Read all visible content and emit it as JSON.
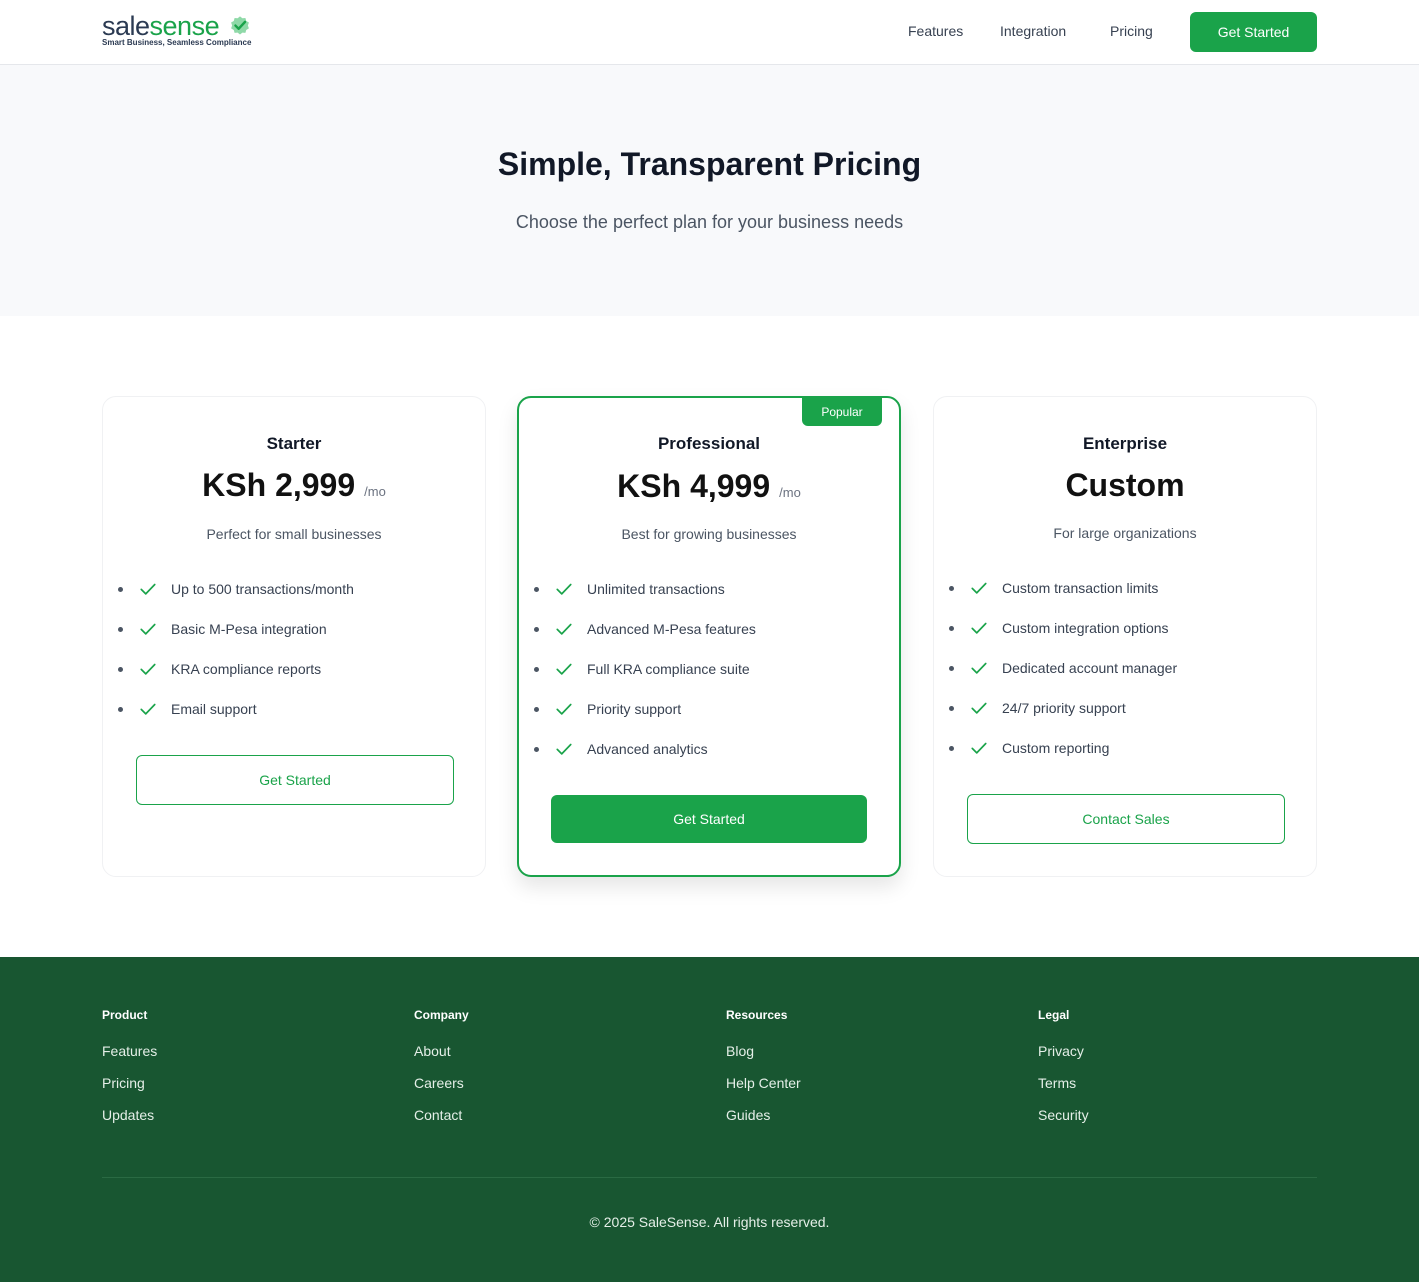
{
  "brand": {
    "name_part1": "sale",
    "name_part2": "sense",
    "tagline": "Smart Business, Seamless Compliance",
    "accent": "#1aa34a"
  },
  "nav": {
    "links": [
      "Features",
      "Integration",
      "Pricing"
    ],
    "cta": "Get Started"
  },
  "hero": {
    "title": "Simple, Transparent Pricing",
    "subtitle": "Choose the perfect plan for your business needs"
  },
  "plans": [
    {
      "name": "Starter",
      "price": "KSh 2,999",
      "period": "/mo",
      "description": "Perfect for small businesses",
      "features": [
        "Up to 500 transactions/month",
        "Basic M-Pesa integration",
        "KRA compliance reports",
        "Email support"
      ],
      "cta": "Get Started"
    },
    {
      "name": "Professional",
      "badge": "Popular",
      "price": "KSh 4,999",
      "period": "/mo",
      "description": "Best for growing businesses",
      "features": [
        "Unlimited transactions",
        "Advanced M-Pesa features",
        "Full KRA compliance suite",
        "Priority support",
        "Advanced analytics"
      ],
      "cta": "Get Started"
    },
    {
      "name": "Enterprise",
      "price": "Custom",
      "description": "For large organizations",
      "features": [
        "Custom transaction limits",
        "Custom integration options",
        "Dedicated account manager",
        "24/7 priority support",
        "Custom reporting"
      ],
      "cta": "Contact Sales"
    }
  ],
  "footer": {
    "columns": [
      {
        "heading": "Product",
        "links": [
          "Features",
          "Pricing",
          "Updates"
        ]
      },
      {
        "heading": "Company",
        "links": [
          "About",
          "Careers",
          "Contact"
        ]
      },
      {
        "heading": "Resources",
        "links": [
          "Blog",
          "Help Center",
          "Guides"
        ]
      },
      {
        "heading": "Legal",
        "links": [
          "Privacy",
          "Terms",
          "Security"
        ]
      }
    ],
    "copyright": "© 2025 SaleSense. All rights reserved.",
    "background": "#185631"
  }
}
